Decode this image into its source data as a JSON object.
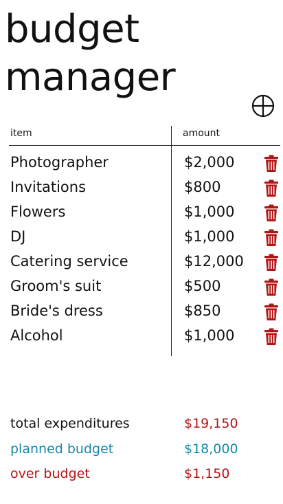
{
  "title": "budget manager",
  "title_lines": [
    "budget",
    "manager"
  ],
  "add_icon": "circle-plus-icon",
  "table": {
    "headers": {
      "item": "item",
      "amount": "amount"
    },
    "delete_icon": "trash-icon",
    "rows": [
      {
        "item": "Photographer",
        "amount": "$2,000"
      },
      {
        "item": "Invitations",
        "amount": "$800"
      },
      {
        "item": "Flowers",
        "amount": "$1,000"
      },
      {
        "item": "DJ",
        "amount": "$1,000"
      },
      {
        "item": "Catering service",
        "amount": "$12,000"
      },
      {
        "item": "Groom's suit",
        "amount": "$500"
      },
      {
        "item": "Bride's dress",
        "amount": "$850"
      },
      {
        "item": "Alcohol",
        "amount": "$1,000"
      }
    ]
  },
  "summary": {
    "total": {
      "label": "total expenditures",
      "value": "$19,150"
    },
    "planned": {
      "label": "planned budget",
      "value": "$18,000"
    },
    "over": {
      "label": "over budget",
      "value": "$1,150"
    }
  },
  "colors": {
    "accent_red": "#b31414",
    "accent_blue": "#1688aa",
    "text": "#111111"
  }
}
